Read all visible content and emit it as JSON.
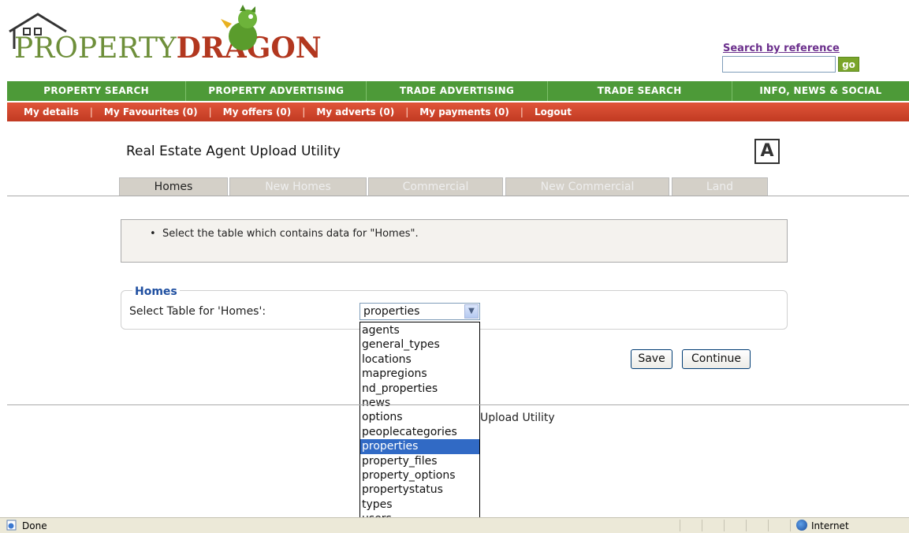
{
  "logo": {
    "part1": "PROPERTY",
    "part2": "DRAGON"
  },
  "search_ref": {
    "label": "Search by reference",
    "input_value": "",
    "go_label": "go"
  },
  "nav_main": [
    "PROPERTY SEARCH",
    "PROPERTY ADVERTISING",
    "TRADE ADVERTISING",
    "TRADE SEARCH",
    "INFO, NEWS & SOCIAL"
  ],
  "nav_user": [
    "My details",
    "My Favourites (0)",
    "My offers (0)",
    "My adverts (0)",
    "My payments (0)",
    "Logout"
  ],
  "nav_user_separator": "|",
  "page_title": "Real Estate Agent Upload Utility",
  "font_size_label": "A",
  "tabs": [
    "Homes",
    "New Homes",
    "Commercial",
    "New Commercial",
    "Land"
  ],
  "info": {
    "bullet": "•",
    "text": "Select the table which contains data for \"Homes\"."
  },
  "homes_section": {
    "legend": "Homes",
    "select_label": "Select Table for 'Homes':",
    "selected_value": "properties",
    "options": [
      "agents",
      "general_types",
      "locations",
      "mapregions",
      "nd_properties",
      "news",
      "options",
      "peoplecategories",
      "properties",
      "property_files",
      "property_options",
      "propertystatus",
      "types",
      "users"
    ],
    "highlighted_option": "properties"
  },
  "buttons": {
    "save": "Save",
    "continue": "Continue"
  },
  "footer_text": "Upload Utility",
  "status_bar": {
    "left": "Done",
    "zone": "Internet"
  },
  "colors": {
    "nav_green": "#4d9a38",
    "nav_red": "#c13a22",
    "legend_blue": "#1f4fa0",
    "link_purple": "#6b2f8c",
    "highlight": "#316ac5"
  }
}
